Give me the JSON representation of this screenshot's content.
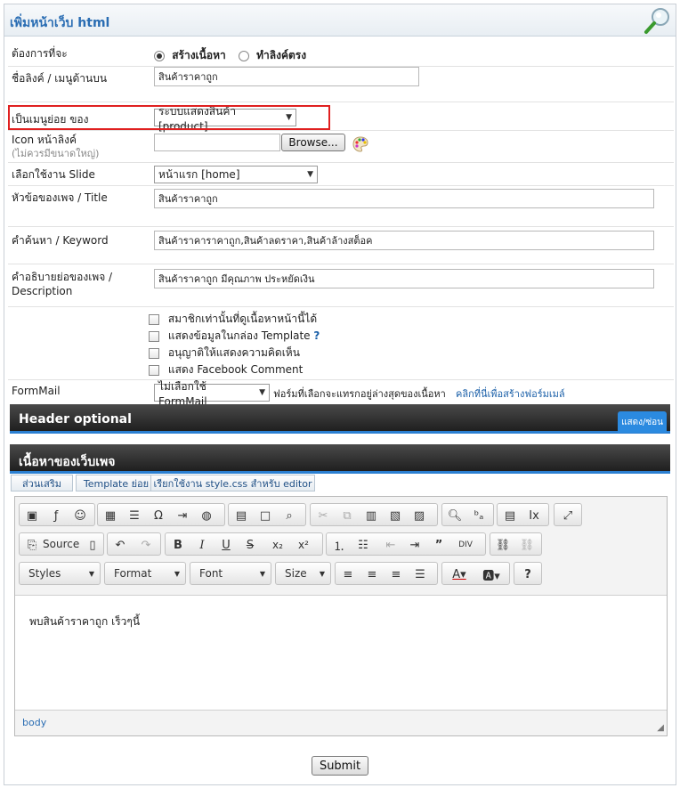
{
  "window": {
    "title": "เพิ่มหน้าเว็บ html",
    "icon": "magnifier-icon"
  },
  "form": {
    "action": {
      "label": "ต้องการที่จะ",
      "options": [
        {
          "label": "สร้างเนื้อหา",
          "selected": true
        },
        {
          "label": "ทำลิงค์ตรง",
          "selected": false
        }
      ]
    },
    "link_name": {
      "label": "ชื่อลิงค์ / เมนูด้านบน",
      "value": "สินค้าราคาถูก"
    },
    "submenu_of": {
      "label": "เป็นเมนูย่อย ของ",
      "value": "ระบบแสดงสินค้า [product]"
    },
    "icon": {
      "label": "Icon หน้าลิงค์",
      "sublabel": "(ไม่ควรมีขนาดใหญ่)",
      "value": "",
      "browse_label": "Browse..."
    },
    "slide": {
      "label": "เลือกใช้งาน Slide",
      "value": "หน้าแรก [home]"
    },
    "title": {
      "label": "หัวข้อของเพจ / Title",
      "value": "สินค้าราคาถูก"
    },
    "keyword": {
      "label": "คำค้นหา / Keyword",
      "value": "สินค้าราคาราคาถูก,สินค้าลดราคา,สินค้าล้างสต็อค"
    },
    "description": {
      "label": "คำอธิบายย่อของเพจ / Description",
      "value": "สินค้าราคาถูก มีคุณภาพ ประหยัดเงิน"
    },
    "checkboxes": [
      {
        "label": "สมาชิกเท่านั้นที่ดูเนื้อหาหน้านี้ได้",
        "checked": false
      },
      {
        "label": "แสดงข้อมูลในกล่อง  Template",
        "checked": false,
        "help": "?"
      },
      {
        "label": "อนุญาติให้แสดงความคิดเห็น",
        "checked": false
      },
      {
        "label": "แสดง Facebook Comment",
        "checked": false
      }
    ],
    "formmail": {
      "label": "FormMail",
      "value": "ไม่เลือกใช้ FormMail",
      "note": "ฟอร์มที่เลือกจะแทรกอยู่ล่างสุดของเนื้อหา",
      "link": "คลิกที่นี่เพื่อสร้างฟอร์มเมล์"
    }
  },
  "header_optional": {
    "title": "Header optional",
    "toggle_label": "แสดง/ซ่อน"
  },
  "page_content": {
    "title": "เนื้อหาของเว็บเพจ",
    "tabs": [
      "ส่วนเสริม",
      "Template ย่อย",
      "เรียกใช้งาน style.css สำหรับ editor"
    ]
  },
  "editor": {
    "source_label": "Source",
    "combos": [
      "Styles",
      "Format",
      "Font",
      "Size"
    ],
    "content": "พบสินค้าราคาถูก เร็วๆนี้",
    "status_path": "body"
  },
  "submit_label": "Submit"
}
